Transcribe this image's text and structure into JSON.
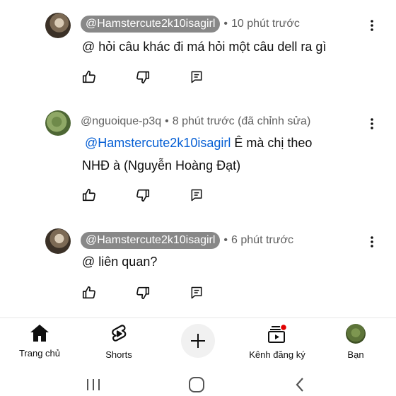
{
  "comments": [
    {
      "handle": "@Hamstercute2k10isagirl",
      "time": "10 phút trước",
      "body": "@ hỏi câu khác đi má hỏi một câu dell ra gì"
    },
    {
      "handle": "@nguoique-p3q",
      "time": "8 phút trước (đã chỉnh sửa)",
      "mention": "@Hamstercute2k10isagirl",
      "body_line1": " Ê mà chị theo",
      "body_line2": "NHĐ à (Nguyễn Hoàng Đạt)"
    },
    {
      "handle": "@Hamstercute2k10isagirl",
      "time": "6 phút trước",
      "body": "@ liên quan?"
    }
  ],
  "separator": "•",
  "nav": {
    "home": "Trang chủ",
    "shorts": "Shorts",
    "subscriptions": "Kênh đăng ký",
    "you": "Bạn"
  },
  "icons": {
    "like": "thumbs-up-icon",
    "dislike": "thumbs-down-icon",
    "reply": "reply-icon",
    "more": "more-vert-icon"
  },
  "colors": {
    "mention": "#065fd4",
    "chip_bg": "#888888",
    "notification_dot": "#e00000"
  }
}
